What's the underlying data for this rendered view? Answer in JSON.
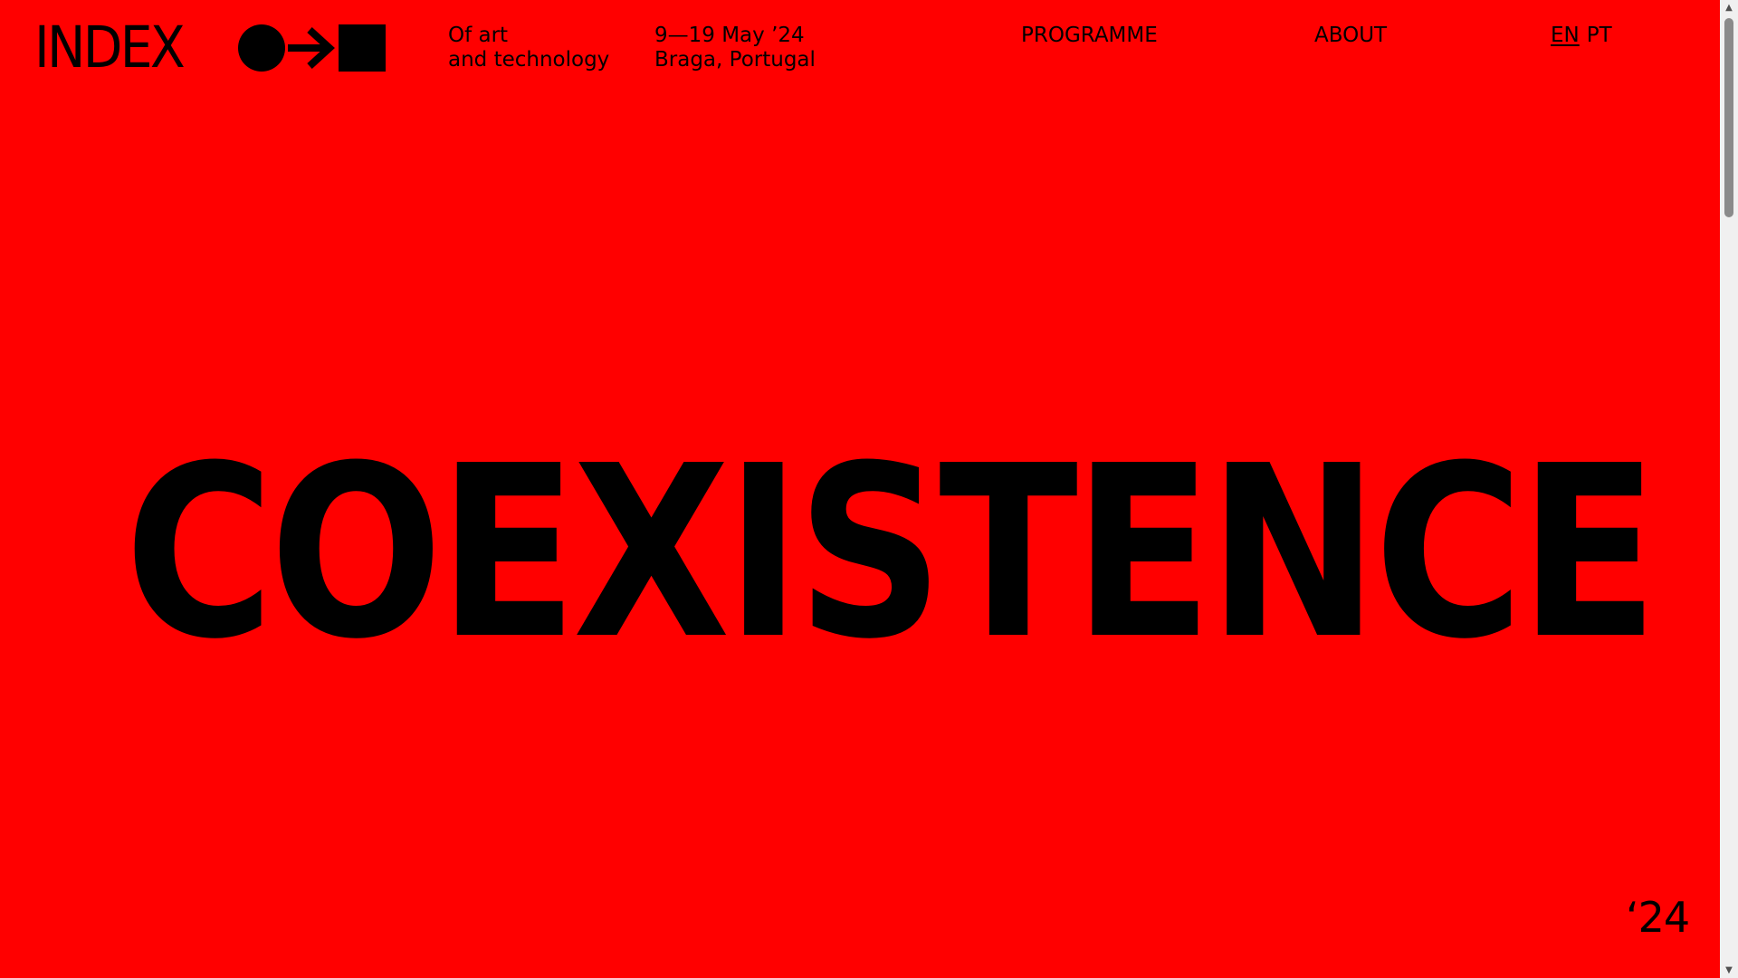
{
  "brand": {
    "wordmark": "INDEX",
    "logo_icons": [
      "circle-icon",
      "arrow-right-icon",
      "square-icon"
    ]
  },
  "tagline": {
    "line1": "Of art",
    "line2": "and technology"
  },
  "event": {
    "dates": "9—19 May ’24",
    "location": "Braga, Portugal"
  },
  "nav": {
    "programme": "PROGRAMME",
    "about": "ABOUT"
  },
  "language": {
    "en": "EN",
    "pt": "PT",
    "selected": "EN"
  },
  "hero": {
    "title": "COEXISTENCE"
  },
  "year_mark": "‘24",
  "colors": {
    "background": "#ff0000",
    "text": "#000000"
  }
}
